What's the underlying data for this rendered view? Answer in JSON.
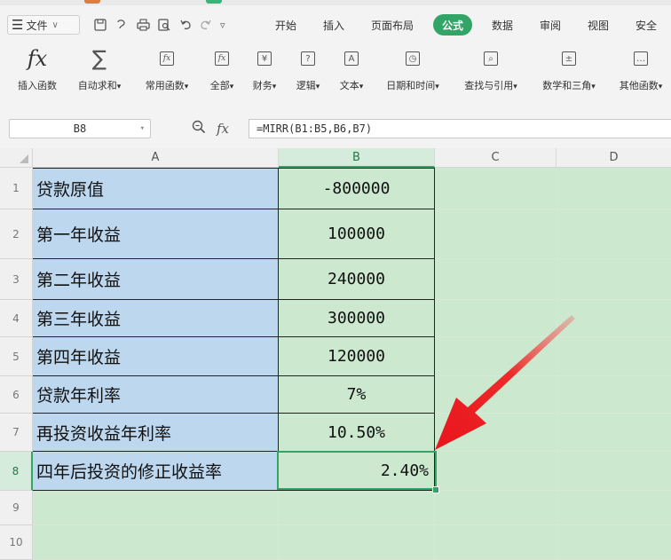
{
  "menu": {
    "file_label": "文件",
    "tabs": [
      {
        "label": "开始",
        "active": false
      },
      {
        "label": "插入",
        "active": false
      },
      {
        "label": "页面布局",
        "active": false
      },
      {
        "label": "公式",
        "active": true
      },
      {
        "label": "数据",
        "active": false
      },
      {
        "label": "审阅",
        "active": false
      },
      {
        "label": "视图",
        "active": false
      },
      {
        "label": "安全",
        "active": false
      }
    ]
  },
  "ribbon": {
    "insert_function": "插入函数",
    "autosum": "自动求和",
    "common_functions": "常用函数",
    "all": "全部",
    "finance": "财务",
    "logic": "逻辑",
    "text": "文本",
    "datetime": "日期和时间",
    "lookup": "查找与引用",
    "math": "数学和三角",
    "other": "其他函数",
    "fx_symbol": "fx",
    "sigma_symbol": "∑",
    "yen_symbol": "¥",
    "question_symbol": "?",
    "letter_symbol": "A",
    "clock_symbol": "◷",
    "search_symbol": "⌕",
    "plusminus_symbol": "±",
    "ellipsis_symbol": "…"
  },
  "formula_bar": {
    "name_box": "B8",
    "fx_label": "fx",
    "formula": "=MIRR(B1:B5,B6,B7)"
  },
  "columns": [
    "A",
    "B",
    "C",
    "D"
  ],
  "rows": [
    {
      "num": "1",
      "a": "贷款原值",
      "b": "-800000"
    },
    {
      "num": "2",
      "a": "第一年收益",
      "b": "100000"
    },
    {
      "num": "3",
      "a": "第二年收益",
      "b": "240000"
    },
    {
      "num": "4",
      "a": "第三年收益",
      "b": "300000"
    },
    {
      "num": "5",
      "a": "第四年收益",
      "b": "120000"
    },
    {
      "num": "6",
      "a": "贷款年利率",
      "b": "7%"
    },
    {
      "num": "7",
      "a": "再投资收益年利率",
      "b": "10.50%"
    },
    {
      "num": "8",
      "a": "四年后投资的修正收益率",
      "b": "2.40%"
    },
    {
      "num": "9",
      "a": "",
      "b": ""
    },
    {
      "num": "10",
      "a": "",
      "b": ""
    }
  ],
  "selected_cell": "B8",
  "colors": {
    "accent": "#31a466",
    "cell_a": "#bdd7ee",
    "cell_bg": "#cce8cf",
    "arrow": "#e8141c"
  }
}
